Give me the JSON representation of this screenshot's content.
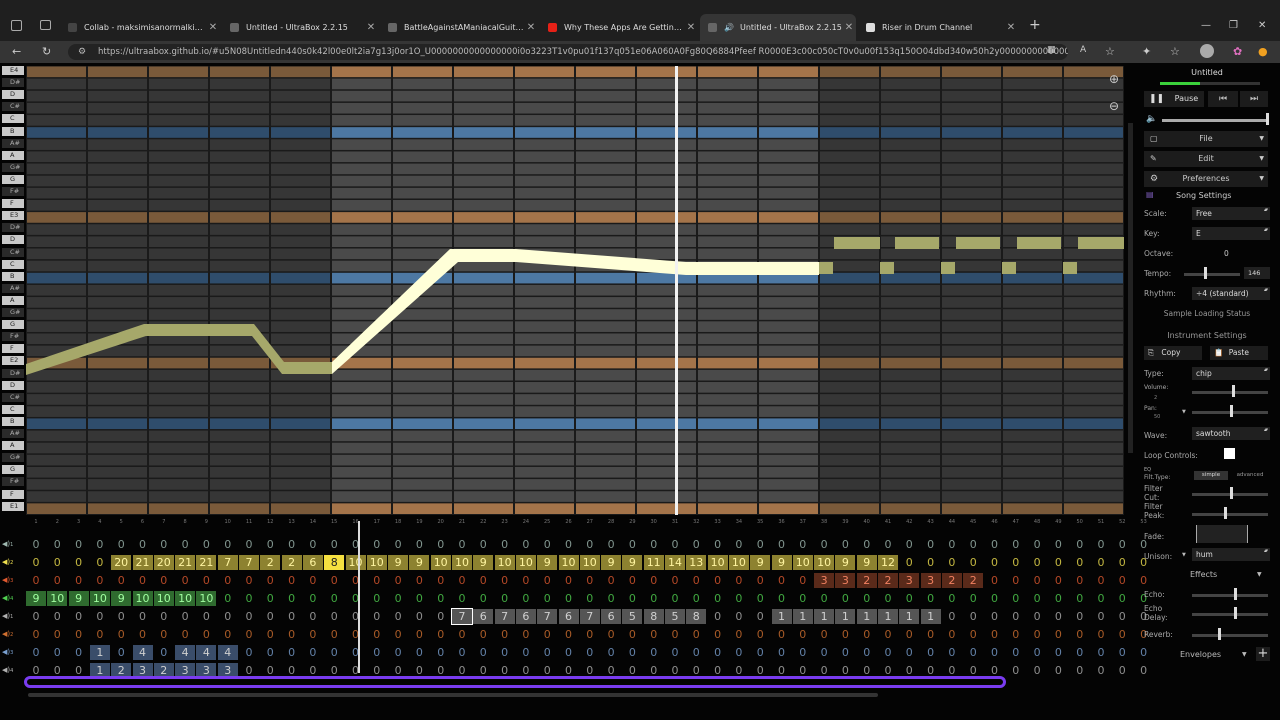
{
  "browser": {
    "tabs": [
      {
        "title": "Collab - maksimisanormalkid@gm",
        "icon": "mail-icon",
        "color": "#444"
      },
      {
        "title": "Untitled - UltraBox 2.2.15",
        "icon": "ultrabox-icon",
        "color": "#666"
      },
      {
        "title": "BattleAgainstAManiacalGuitaris",
        "icon": "ultrabox-icon",
        "color": "#666"
      },
      {
        "title": "Why These Apps Are Getting Hea",
        "icon": "youtube-icon",
        "color": "#e62117"
      },
      {
        "title": "Untitled - UltraBox 2.2.15",
        "icon": "ultrabox-icon",
        "color": "#666",
        "active": true
      },
      {
        "title": "Riser in Drum Channel",
        "icon": "discord-icon",
        "color": "#ddd"
      }
    ],
    "url": "https://ultraabox.github.io/#u5N08Untitledn440s0k42l00e0lt2ia7g13j0or1O_U0000000000000000i0o3223T1v0pu01f137q051e06A060A0Fg80Q6884Pfeef R0000E3c00c050cT0v0u00f153q150O04dbd340w50h2y00000000000000..."
  },
  "piano": {
    "keys": [
      "E4",
      "D#",
      "D",
      "C#",
      "C",
      "B",
      "A#",
      "A",
      "G#",
      "G",
      "F#",
      "F",
      "E3",
      "D#",
      "D",
      "C#",
      "C",
      "B",
      "A#",
      "A",
      "G#",
      "G",
      "F#",
      "F",
      "E2",
      "D#",
      "D",
      "C#",
      "C",
      "B",
      "A#",
      "A",
      "G#",
      "G",
      "F#",
      "F",
      "E1"
    ],
    "colors": {
      "bg": "#363636",
      "bgLoop": "#4a4a4a",
      "orange": "#7a5a3a",
      "orangeLoop": "#a4744a",
      "blue": "#2f4d6c",
      "blueLoop": "#4d78a3",
      "green": "#a6a86a",
      "cream": "#ffffd8"
    }
  },
  "pattern": {
    "channels": [
      "1",
      "2",
      "3",
      "4",
      "1",
      "2",
      "3",
      "4"
    ],
    "rows": [
      [
        "0",
        "0",
        "0",
        "0",
        "0",
        "0",
        "0",
        "0",
        "0",
        "0",
        "0",
        "0",
        "0",
        "0",
        "0",
        "0",
        "0",
        "0",
        "0",
        "0",
        "0",
        "0",
        "0",
        "0",
        "0",
        "0",
        "0",
        "0",
        "0",
        "0",
        "0",
        "0",
        "0",
        "0",
        "0",
        "0",
        "0",
        "0",
        "0",
        "0",
        "0",
        "0",
        "0",
        "0",
        "0",
        "0",
        "0",
        "0",
        "0",
        "0",
        "0",
        "0",
        "0"
      ],
      [
        "0",
        "0",
        "0",
        "0",
        "20",
        "21",
        "20",
        "21",
        "21",
        "7",
        "7",
        "2",
        "2",
        "6",
        "8",
        "10",
        "10",
        "9",
        "9",
        "10",
        "10",
        "9",
        "10",
        "10",
        "9",
        "10",
        "10",
        "9",
        "9",
        "11",
        "14",
        "13",
        "10",
        "10",
        "9",
        "9",
        "10",
        "10",
        "9",
        "9",
        "12",
        "0",
        "0",
        "0",
        "0",
        "0",
        "0",
        "0",
        "0",
        "0",
        "0",
        "0",
        "0"
      ],
      [
        "0",
        "0",
        "0",
        "0",
        "0",
        "0",
        "0",
        "0",
        "0",
        "0",
        "0",
        "0",
        "0",
        "0",
        "0",
        "0",
        "0",
        "0",
        "0",
        "0",
        "0",
        "0",
        "0",
        "0",
        "0",
        "0",
        "0",
        "0",
        "0",
        "0",
        "0",
        "0",
        "0",
        "0",
        "0",
        "0",
        "0",
        "3",
        "3",
        "2",
        "2",
        "3",
        "3",
        "2",
        "2",
        "0",
        "0",
        "0",
        "0",
        "0",
        "0",
        "0",
        "0"
      ],
      [
        "9",
        "10",
        "9",
        "10",
        "9",
        "10",
        "10",
        "10",
        "10",
        "0",
        "0",
        "0",
        "0",
        "0",
        "0",
        "0",
        "0",
        "0",
        "0",
        "0",
        "0",
        "0",
        "0",
        "0",
        "0",
        "0",
        "0",
        "0",
        "0",
        "0",
        "0",
        "0",
        "0",
        "0",
        "0",
        "0",
        "0",
        "0",
        "0",
        "0",
        "0",
        "0",
        "0",
        "0",
        "0",
        "0",
        "0",
        "0",
        "0",
        "0",
        "0",
        "0",
        "0"
      ],
      [
        "0",
        "0",
        "0",
        "0",
        "0",
        "0",
        "0",
        "0",
        "0",
        "0",
        "0",
        "0",
        "0",
        "0",
        "0",
        "0",
        "0",
        "0",
        "0",
        "0",
        "7",
        "6",
        "7",
        "6",
        "7",
        "6",
        "7",
        "6",
        "5",
        "8",
        "5",
        "8",
        "0",
        "0",
        "0",
        "1",
        "1",
        "1",
        "1",
        "1",
        "1",
        "1",
        "1",
        "0",
        "0",
        "0",
        "0",
        "0",
        "0",
        "0",
        "0",
        "0",
        "0"
      ],
      [
        "0",
        "0",
        "0",
        "0",
        "0",
        "0",
        "0",
        "0",
        "0",
        "0",
        "0",
        "0",
        "0",
        "0",
        "0",
        "0",
        "0",
        "0",
        "0",
        "0",
        "0",
        "0",
        "0",
        "0",
        "0",
        "0",
        "0",
        "0",
        "0",
        "0",
        "0",
        "0",
        "0",
        "0",
        "0",
        "0",
        "0",
        "0",
        "0",
        "0",
        "0",
        "0",
        "0",
        "0",
        "0",
        "0",
        "0",
        "0",
        "0",
        "0",
        "0",
        "0",
        "0"
      ],
      [
        "0",
        "0",
        "0",
        "1",
        "0",
        "4",
        "0",
        "4",
        "4",
        "4",
        "0",
        "0",
        "0",
        "0",
        "0",
        "0",
        "0",
        "0",
        "0",
        "0",
        "0",
        "0",
        "0",
        "0",
        "0",
        "0",
        "0",
        "0",
        "0",
        "0",
        "0",
        "0",
        "0",
        "0",
        "0",
        "0",
        "0",
        "0",
        "0",
        "0",
        "0",
        "0",
        "0",
        "0",
        "0",
        "0",
        "0",
        "0",
        "0",
        "0",
        "0",
        "0",
        "0"
      ],
      [
        "0",
        "0",
        "0",
        "1",
        "2",
        "3",
        "2",
        "3",
        "3",
        "3",
        "0",
        "0",
        "0",
        "0",
        "0",
        "0",
        "0",
        "0",
        "0",
        "0",
        "0",
        "0",
        "0",
        "0",
        "0",
        "0",
        "0",
        "0",
        "0",
        "0",
        "0",
        "0",
        "0",
        "0",
        "0",
        "0",
        "0",
        "0",
        "0",
        "0",
        "0",
        "0",
        "0",
        "0",
        "0",
        "0",
        "0",
        "0",
        "0",
        "0",
        "0",
        "0",
        "0"
      ]
    ],
    "rowColors": [
      "#9fb8b0",
      "#f0e050",
      "#e05a30",
      "#50d050",
      "#b0b0b0",
      "#d07030",
      "#7aa0d0",
      "#b0b0b0"
    ]
  },
  "panel": {
    "title": "Untitled",
    "pause": "Pause",
    "file": "File",
    "edit": "Edit",
    "preferences": "Preferences",
    "songSettings": "Song Settings",
    "scaleLabel": "Scale:",
    "scale": "Free",
    "keyLabel": "Key:",
    "key": "E",
    "octaveLabel": "Octave:",
    "octave": "0",
    "tempoLabel": "Tempo:",
    "tempo": "146",
    "rhythmLabel": "Rhythm:",
    "rhythm": "÷4 (standard)",
    "sampleStatus": "Sample Loading Status",
    "instrumentSettings": "Instrument Settings",
    "copy": "Copy",
    "paste": "Paste",
    "typeLabel": "Type:",
    "type": "chip",
    "volumeLabel": "Volume:",
    "volumeVal": "2",
    "panLabel": "Pan:",
    "panVal": "50",
    "waveLabel": "Wave:",
    "wave": "sawtooth",
    "loopLabel": "Loop Controls:",
    "eqLabel": "EQ",
    "filtTypeLabel": "Filt.Type:",
    "simple": "simple",
    "advanced": "advanced",
    "filterCutLabel": "Filter\nCut:",
    "filterPeakLabel": "Filter\nPeak:",
    "fadeLabel": "Fade:",
    "unisonLabel": "Unison:",
    "unison": "hum",
    "effectsLabel": "Effects",
    "echoLabel": "Echo:",
    "echoDelayLabel": "Echo\nDelay:",
    "reverbLabel": "Reverb:",
    "envelopesLabel": "Envelopes"
  }
}
